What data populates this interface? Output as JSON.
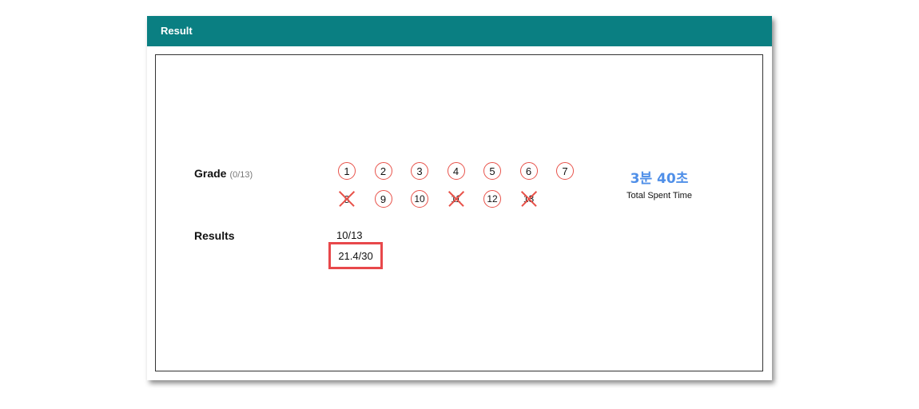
{
  "header": {
    "title": "Result"
  },
  "grade": {
    "label": "Grade",
    "count": "(0/13)"
  },
  "questions": [
    {
      "number": "1",
      "status": "correct"
    },
    {
      "number": "2",
      "status": "correct"
    },
    {
      "number": "3",
      "status": "correct"
    },
    {
      "number": "4",
      "status": "correct"
    },
    {
      "number": "5",
      "status": "correct"
    },
    {
      "number": "6",
      "status": "correct"
    },
    {
      "number": "7",
      "status": "correct"
    },
    {
      "number": "8",
      "status": "wrong"
    },
    {
      "number": "9",
      "status": "correct"
    },
    {
      "number": "10",
      "status": "correct"
    },
    {
      "number": "11",
      "status": "wrong"
    },
    {
      "number": "12",
      "status": "correct"
    },
    {
      "number": "13",
      "status": "wrong"
    }
  ],
  "time": {
    "value": "3분 40초",
    "caption": "Total Spent Time"
  },
  "results": {
    "label": "Results",
    "correct_count": "10/13",
    "score": "21.4/30"
  },
  "colors": {
    "header_bg": "#0a7f82",
    "circle_stroke": "#e8524a",
    "time_text": "#4f8fe8",
    "highlight_box": "#e8484b"
  }
}
